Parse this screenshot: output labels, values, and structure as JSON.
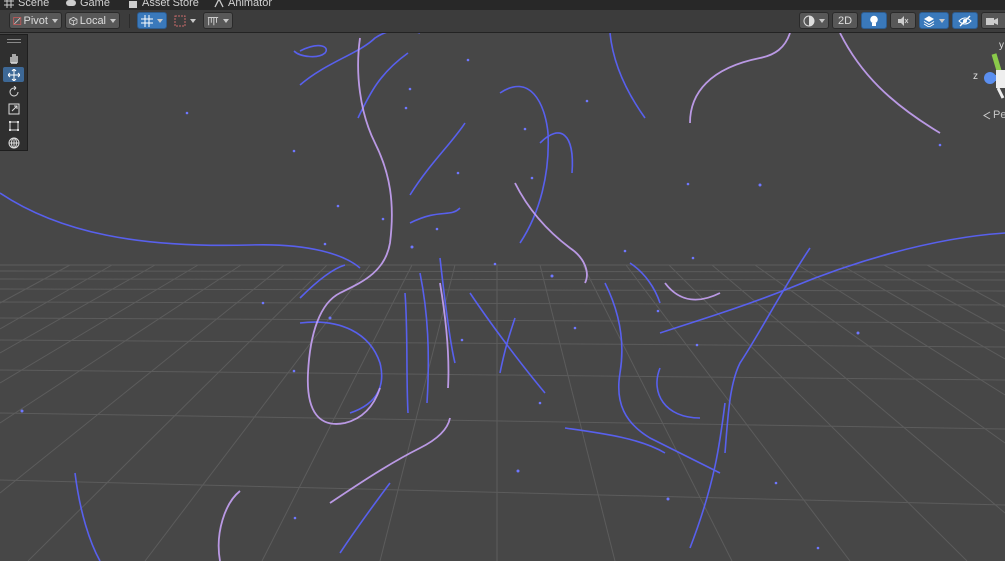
{
  "tabs": [
    {
      "label": "Scene",
      "icon": "grid-icon"
    },
    {
      "label": "Game",
      "icon": "gamepad-icon"
    },
    {
      "label": "Asset Store",
      "icon": "store-bag-icon"
    },
    {
      "label": "Animator",
      "icon": "animator-icon"
    }
  ],
  "toolbar": {
    "pivot_label": "Pivot",
    "local_label": "Local",
    "mode_2d_label": "2D"
  },
  "gizmo": {
    "axis_y": "y",
    "axis_z": "z",
    "projection_label": "Pe"
  },
  "colors": {
    "background": "#474747",
    "grid": "#5b5b5b",
    "particle_blue": "#5a63ff",
    "particle_lavender": "#c7a2f5",
    "tool_active": "#3d6896"
  }
}
